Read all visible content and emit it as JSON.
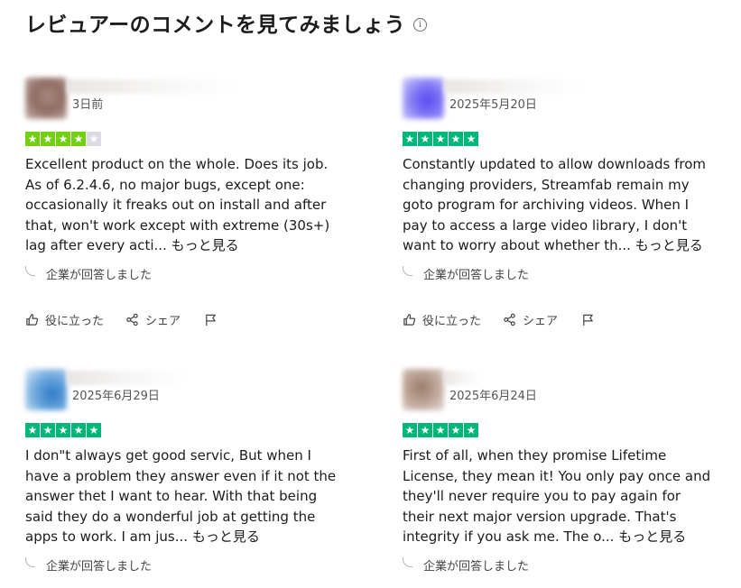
{
  "header": {
    "title": "レビュアーのコメントを見てみましょう",
    "info_icon": "info-icon"
  },
  "colors": {
    "star_green": "#00b67a",
    "star_lime": "#73cf11",
    "star_empty": "#dcdce6"
  },
  "reviews": [
    {
      "date": "3日前",
      "rating": 4,
      "text": "Excellent product on the whole. Does its job. As of 6.2.4.6, no major bugs, except one: occasionally it freaks out on install and after that, won't work except with extreme (30s+) lag after every acti...",
      "more": "もっと見る",
      "reply": "企業が回答しました",
      "helpful": "役に立った",
      "share": "シェア"
    },
    {
      "date": "2025年5月20日",
      "rating": 5,
      "text": "Constantly updated to allow downloads from changing providers, Streamfab remain my goto program for archiving videos. When I pay to access a large video library, I don't want to worry about whether th...",
      "more": "もっと見る",
      "reply": "企業が回答しました",
      "helpful": "役に立った",
      "share": "シェア"
    },
    {
      "date": "2025年6月29日",
      "rating": 5,
      "text": "I don\"t always get good servic, But when I have a problem they answer even if it not the answer thet I want to hear. With that being said they do a wonderful job at getting the apps to work. I am jus...",
      "more": "もっと見る",
      "reply": "企業が回答しました"
    },
    {
      "date": "2025年6月24日",
      "rating": 5,
      "text": "First of all, when they promise Lifetime License, they mean it! You only pay once and they'll never require you to pay again for their next major version upgrade. That's integrity if you ask me. The o...",
      "more": "もっと見る",
      "reply": "企業が回答しました"
    }
  ]
}
